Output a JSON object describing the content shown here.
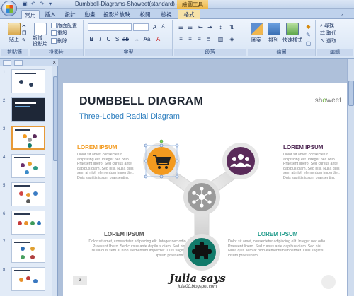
{
  "window": {
    "title": "Dumbbell-Diagrams-Showeet(standard) - Micr",
    "context_tab_title": "繪圖工具"
  },
  "tabs": [
    {
      "label": "常用",
      "active": true
    },
    {
      "label": "插入"
    },
    {
      "label": "設計"
    },
    {
      "label": "動畫"
    },
    {
      "label": "投影片放映"
    },
    {
      "label": "校閱"
    },
    {
      "label": "檢視"
    },
    {
      "label": "格式",
      "context": true
    }
  ],
  "ribbon": {
    "clipboard": {
      "label": "剪貼簿",
      "paste": "貼上"
    },
    "slides": {
      "label": "投影片",
      "new_slide": "新增\n投影片",
      "layout": "版面配置",
      "reset": "重設",
      "delete": "刪除"
    },
    "font": {
      "label": "字型",
      "font_name": "",
      "font_size": ""
    },
    "paragraph": {
      "label": "段落"
    },
    "drawing": {
      "label": "繪圖",
      "shapes": "圖案",
      "arrange": "排列",
      "quick_styles": "快速樣式"
    },
    "editing": {
      "label": "編輯",
      "find": "尋找",
      "replace": "取代",
      "select": "選取"
    }
  },
  "panel": {
    "slides": [
      {
        "num": "1"
      },
      {
        "num": "2"
      },
      {
        "num": "3",
        "selected": true
      },
      {
        "num": "4"
      },
      {
        "num": "5"
      },
      {
        "num": "6"
      },
      {
        "num": "7"
      },
      {
        "num": "8"
      }
    ]
  },
  "slide": {
    "title": "DUMBBELL DIAGRAM",
    "subtitle": "Three-Lobed Radial Diagram",
    "brand_prefix": "sh",
    "brand_suffix": "weet",
    "brand_leaf": "o",
    "page_number": "3",
    "blocks": [
      {
        "heading": "LOREM IPSUM",
        "color": "#f39a1f",
        "body": "Dolor sit amet, consectetur adipiscing elit. Integer nec odio. Praesent libero. Sed cursus ante dapibus diam. Sed nisi. Nulla quis sem at nibh elementum imperdiet. Duis sagittis ipsum praesentim."
      },
      {
        "heading": "LOREM IPSUM",
        "color": "#4b2350",
        "body": "Dolor sit amet, consectetur adipiscing elit. Integer nec odio. Praesent libero. Sed cursus ante dapibus diam. Sed nisi. Nulla quis sem at nibh elementum imperdiet. Duis sagittis ipsum praesentim."
      },
      {
        "heading": "LOREM IPSUM",
        "color": "#555555",
        "body": "Dolor sit amet, consectetur adipiscing elit. Integer nec odio. Praesent libero. Sed cursus ante dapibus diam. Sed nisi. Nulla quis sem at nibh elementum imperdiet. Duis sagittis ipsum praesentim."
      },
      {
        "heading": "LOREM IPSUM",
        "color": "#1f9a8a",
        "body": "Dolor sit amet, consectetur adipiscing elit. Integer nec odio. Praesent libero. Sed cursus ante dapibus diam. Sed nisi. Nulla quis sem at nibh elementum imperdiet. Duis sagittis ipsum praesentim."
      }
    ],
    "lobes": [
      {
        "icon": "shopping-cart-icon",
        "color": "#f39a1f"
      },
      {
        "icon": "people-group-icon",
        "color": "#5a2b5a"
      },
      {
        "icon": "network-hub-icon",
        "color": "#9a9a9a"
      },
      {
        "icon": "puzzle-piece-icon",
        "color": "#127a6a"
      }
    ],
    "watermark": {
      "main": "Julia says",
      "sub": "julia00.blogspot.com"
    }
  }
}
